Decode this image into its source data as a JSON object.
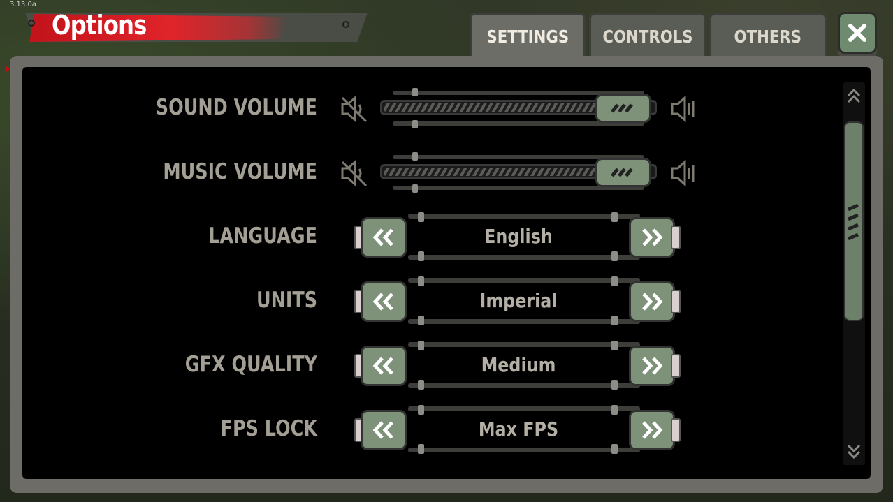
{
  "version": "3.13.0a",
  "title": "Options",
  "tabs": [
    {
      "label": "SETTINGS",
      "active": true
    },
    {
      "label": "CONTROLS",
      "active": false
    },
    {
      "label": "OTHERS",
      "active": false
    }
  ],
  "close_icon": "close-x-icon",
  "sliders": [
    {
      "label": "SOUND VOLUME",
      "value_fraction": 0.9
    },
    {
      "label": "MUSIC VOLUME",
      "value_fraction": 0.9
    }
  ],
  "selectors": [
    {
      "label": "LANGUAGE",
      "value": "English"
    },
    {
      "label": "UNITS",
      "value": "Imperial"
    },
    {
      "label": "GFX QUALITY",
      "value": "Medium"
    },
    {
      "label": "FPS LOCK",
      "value": "Max FPS"
    }
  ],
  "colors": {
    "accent_red": "#e0242a",
    "button_green": "#7d9279",
    "label_gray": "#a39f94"
  }
}
